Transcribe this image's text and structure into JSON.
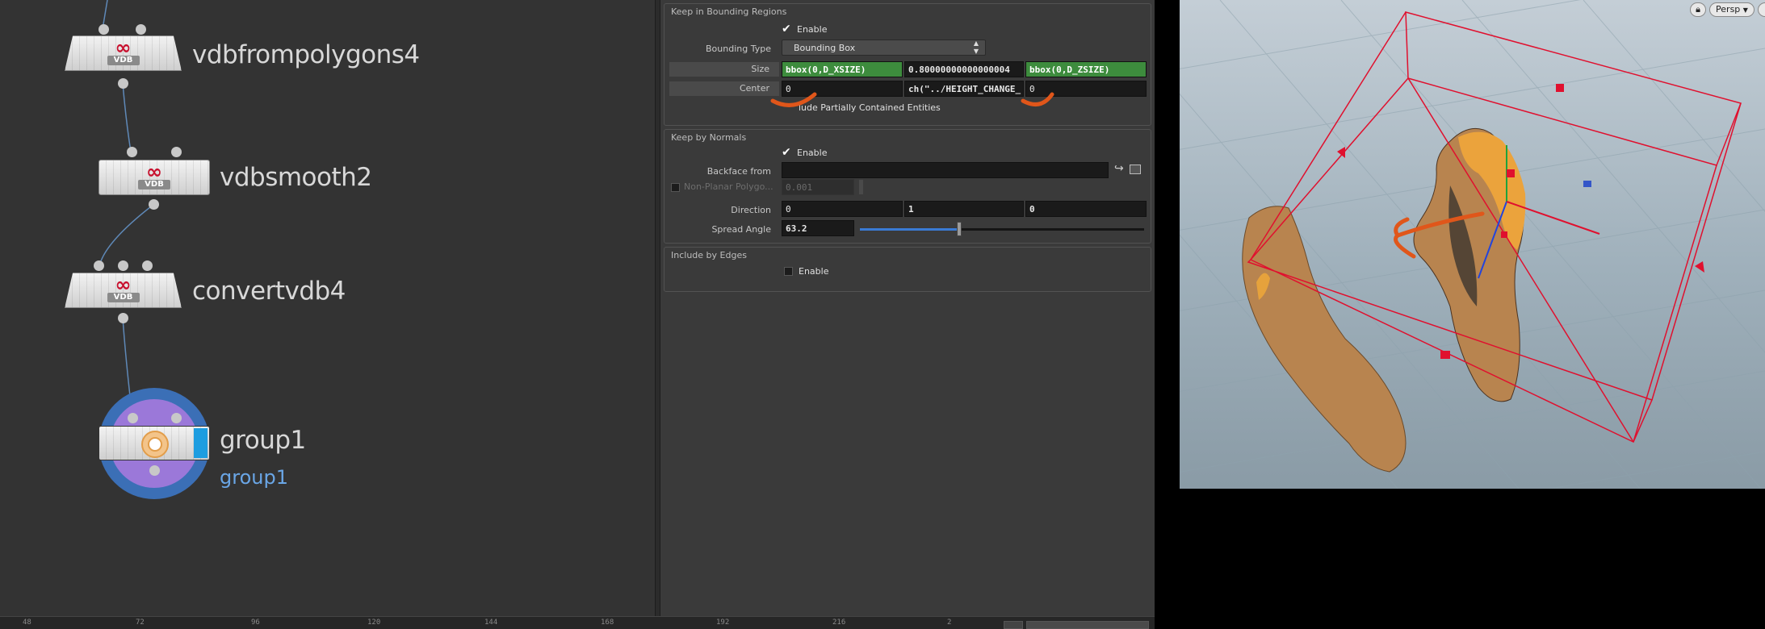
{
  "network": {
    "nodes": [
      {
        "name": "vdbfrompolygons4",
        "logo": "VDB"
      },
      {
        "name": "vdbsmooth2",
        "logo": "VDB"
      },
      {
        "name": "convertvdb4",
        "logo": "VDB"
      },
      {
        "name": "group1",
        "sublabel": "group1"
      }
    ]
  },
  "timeline": {
    "ticks": [
      "48",
      "72",
      "96",
      "120",
      "144",
      "168",
      "192",
      "216",
      "2"
    ]
  },
  "params": {
    "bounding": {
      "title": "Keep in Bounding Regions",
      "enable_label": "Enable",
      "bounding_type_label": "Bounding Type",
      "bounding_type_value": "Bounding Box",
      "size_label": "Size",
      "size_values": [
        "bbox(0,D_XSIZE)",
        "0.80000000000000004",
        "bbox(0,D_ZSIZE)"
      ],
      "center_label": "Center",
      "center_values": [
        "0",
        "ch(\"../HEIGHT_CHANGE_",
        "0"
      ],
      "partial_label": "lude Partially Contained Entities"
    },
    "normals": {
      "title": "Keep by Normals",
      "enable_label": "Enable",
      "backface_label": "Backface from",
      "backface_value": "",
      "nonplanar_label": "Non-Planar Polygo...",
      "nonplanar_value": "0.001",
      "direction_label": "Direction",
      "direction_values": [
        "0",
        "1",
        "0"
      ],
      "spread_label": "Spread Angle",
      "spread_value": "63.2",
      "spread_fraction": 0.35
    },
    "edges": {
      "title": "Include by Edges",
      "enable_label": "Enable"
    }
  },
  "viewport": {
    "camera_label": "Persp",
    "camera_menu_icon": "chevron-down-icon",
    "lock_icon": "lock-icon"
  },
  "colors": {
    "accent_green": "#3d8c3d",
    "annotation_orange": "#e0561a",
    "bbox_red": "#e0102e",
    "mesh_tan": "#b8844f"
  }
}
